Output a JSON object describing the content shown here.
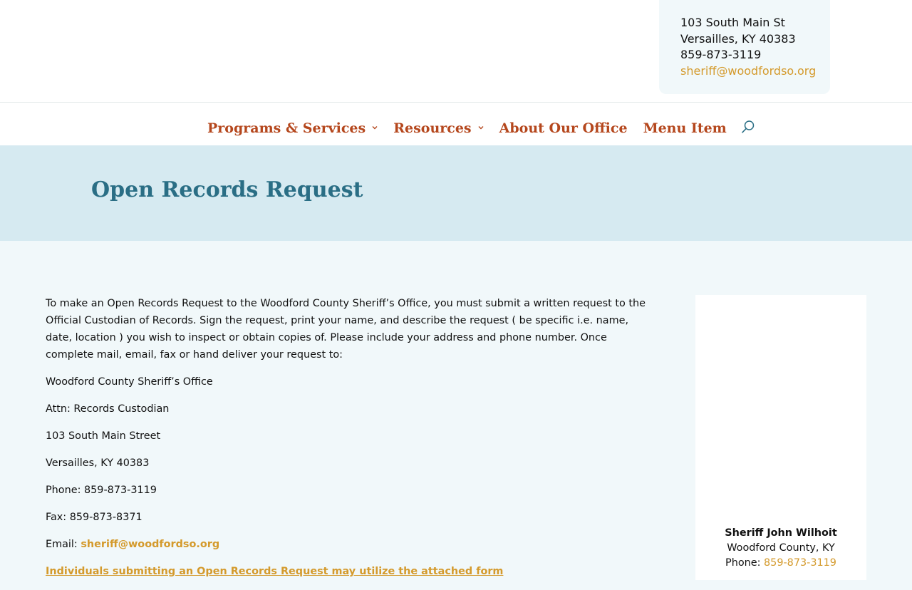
{
  "contact": {
    "address_line1": "103 South Main St",
    "address_line2": "Versailles, KY 40383",
    "phone": "859-873-3119",
    "email": "sheriff@woodfordso.org"
  },
  "nav": {
    "items": [
      {
        "label": "Programs & Services",
        "has_dropdown": true
      },
      {
        "label": "Resources",
        "has_dropdown": true
      },
      {
        "label": "About Our Office",
        "has_dropdown": false
      },
      {
        "label": "Menu Item",
        "has_dropdown": false
      }
    ],
    "search_icon": "search-icon"
  },
  "banner": {
    "title": "Open Records Request"
  },
  "content": {
    "intro": "To make an Open Records Request to the Woodford County Sheriff’s Office, you must submit a written request to the Official Custodian of Records. Sign the request, print your name, and describe the request ( be specific i.e. name, date, location ) you wish to inspect or obtain copies of.  Please include your address and phone number.  Once complete mail, email, fax or hand deliver your request to:",
    "office": "Woodford County Sheriff’s Office",
    "attn": "Attn: Records Custodian",
    "street": "103 South Main Street",
    "city": "Versailles, KY 40383",
    "phone": "Phone: 859-873-3119",
    "fax": "Fax: 859-873-8371",
    "email_label": "Email: ",
    "email": "sheriff@woodfordso.org",
    "attached_link": "Individuals submitting an Open Records Request may utilize the attached form"
  },
  "sidebar": {
    "name": "Sheriff John Wilhoit",
    "location": "Woodford County, KY",
    "phone_label": "Phone: ",
    "phone": "859-873-3119"
  },
  "colors": {
    "nav_text": "#b5471d",
    "title": "#2a6e85",
    "link": "#d49a2c",
    "banner_bg": "#d6eaf1",
    "page_bg": "#f1f8fa"
  }
}
